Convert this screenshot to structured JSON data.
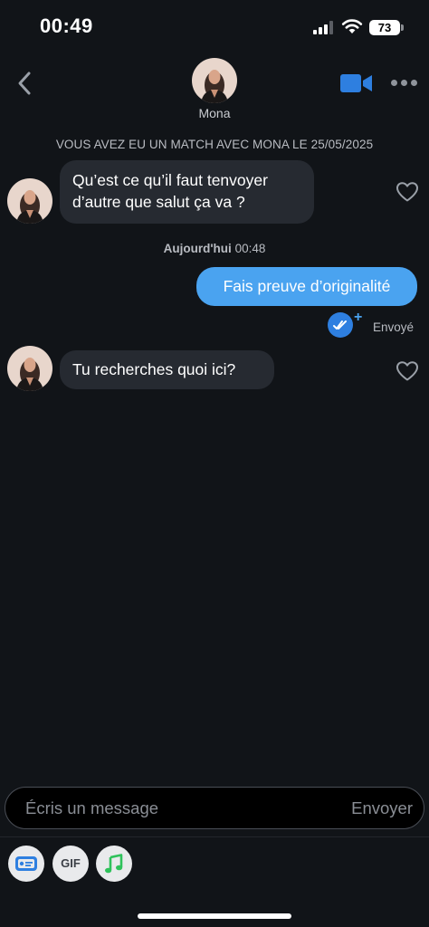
{
  "status_bar": {
    "time": "00:49",
    "battery": "73"
  },
  "header": {
    "contact_name": "Mona",
    "back_icon": "chevron-left-icon",
    "video_icon": "video-camera-icon",
    "more_icon": "more-dots-icon"
  },
  "match_banner": "VOUS AVEZ EU UN MATCH AVEC MONA LE 25/05/2025",
  "messages": {
    "first": {
      "line1": "Qu’est ce qu’il faut tenvoyer",
      "line2": "d’autre que salut ça va ?"
    },
    "day_separator": {
      "day": "Aujourd'hui",
      "time": "00:48"
    },
    "sent": {
      "text": "Fais preuve d’originalité",
      "status": "Envoyé"
    },
    "second": {
      "text": "Tu recherches quoi ici?"
    }
  },
  "composer": {
    "placeholder": "Écris un message",
    "send_label": "Envoyer"
  },
  "toolbar": {
    "gif_label": "GIF",
    "icons": [
      "contact-card-icon",
      "gif-icon",
      "music-note-icon"
    ]
  },
  "colors": {
    "background": "#111418",
    "incoming_bubble": "#262a31",
    "outgoing_bubble": "#4aa3f0",
    "accent": "#2e7fe0"
  }
}
